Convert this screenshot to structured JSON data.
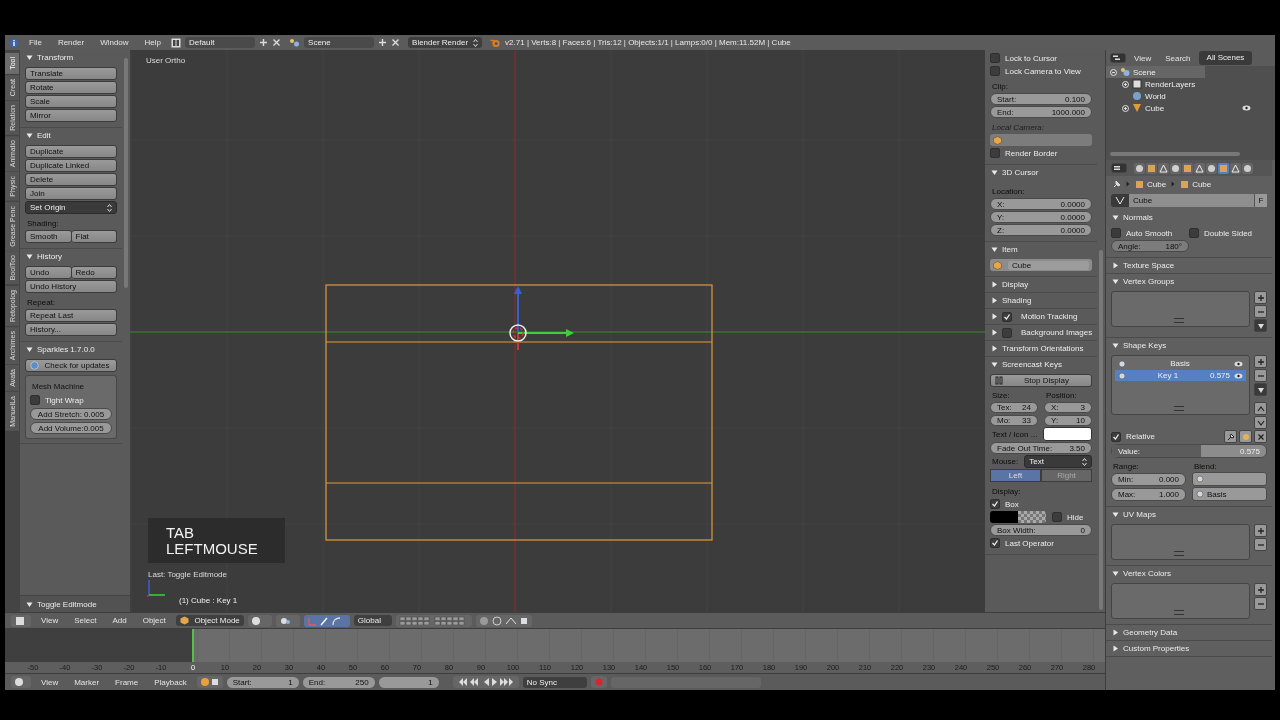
{
  "header": {
    "menus": [
      "File",
      "Render",
      "Window",
      "Help"
    ],
    "layout": "Default",
    "scene": "Scene",
    "engine": "Blender Render",
    "stats": "v2.71 | Verts:8 | Faces:6 | Tris:12 | Objects:1/1 | Lamps:0/0 | Mem:11.52M | Cube"
  },
  "tool_tabs": [
    {
      "label": "Tool",
      "selected": true
    },
    {
      "label": "Creat",
      "selected": false
    },
    {
      "label": "Relation",
      "selected": false
    },
    {
      "label": "Animatio",
      "selected": false
    },
    {
      "label": "Physic",
      "selected": false
    },
    {
      "label": "Grease Penc",
      "selected": false
    },
    {
      "label": "BoolToo",
      "selected": false
    },
    {
      "label": "Retopolog",
      "selected": false
    },
    {
      "label": "Archimes",
      "selected": false
    },
    {
      "label": "Avata",
      "selected": false
    },
    {
      "label": "ManuelLa",
      "selected": false
    }
  ],
  "tool_panel": {
    "sections": [
      {
        "title": "Transform",
        "expanded": true,
        "rows": [
          {
            "kind": "buttons",
            "labels": [
              "Translate"
            ]
          },
          {
            "kind": "buttons",
            "labels": [
              "Rotate"
            ]
          },
          {
            "kind": "buttons",
            "labels": [
              "Scale"
            ]
          },
          {
            "kind": "buttons",
            "labels": [
              "Mirror"
            ]
          }
        ]
      },
      {
        "title": "Edit",
        "expanded": true,
        "rows": [
          {
            "kind": "buttons",
            "labels": [
              "Duplicate"
            ]
          },
          {
            "kind": "buttons",
            "labels": [
              "Duplicate Linked"
            ]
          },
          {
            "kind": "buttons",
            "labels": [
              "Delete"
            ]
          },
          {
            "kind": "buttons",
            "labels": [
              "Join"
            ]
          },
          {
            "kind": "menu",
            "value": "Set Origin"
          },
          {
            "kind": "label",
            "text": "Shading:"
          },
          {
            "kind": "buttons",
            "labels": [
              "Smooth",
              "Flat"
            ]
          }
        ]
      },
      {
        "title": "History",
        "expanded": true,
        "rows": [
          {
            "kind": "buttons",
            "labels": [
              "Undo",
              "Redo"
            ]
          },
          {
            "kind": "buttons",
            "labels": [
              "Undo History"
            ]
          },
          {
            "kind": "label",
            "text": "Repeat:"
          },
          {
            "kind": "buttons",
            "labels": [
              "Repeat Last"
            ]
          },
          {
            "kind": "buttons",
            "labels": [
              "History..."
            ]
          }
        ]
      },
      {
        "title": "Sparkles 1.7.0.0",
        "expanded": true,
        "rows": [
          {
            "kind": "update_button",
            "label": "Check for updates"
          },
          {
            "kind": "box",
            "rows": [
              {
                "kind": "label",
                "text": "Mesh Machine"
              },
              {
                "kind": "checkbox",
                "label": "Tight Wrap",
                "checked": false
              },
              {
                "kind": "spin",
                "text": "Add Stretch: 0.005"
              },
              {
                "kind": "spin",
                "text": "Add Volume:0.005"
              }
            ]
          }
        ]
      }
    ],
    "operator": {
      "title": "Toggle Editmode",
      "expanded": true
    }
  },
  "viewport": {
    "view_name": "User Ortho",
    "keys": [
      "TAB",
      "LEFTMOUSE"
    ],
    "last_operator": "Last: Toggle Editmode",
    "object_info": "(1) Cube : Key 1"
  },
  "n_panel": {
    "sections": [
      {
        "rows": [
          {
            "kind": "checkbox",
            "label": "Lock to Cursor",
            "checked": false
          },
          {
            "kind": "checkbox",
            "label": "Lock Camera to View",
            "checked": false
          },
          {
            "kind": "label",
            "text": "Clip:"
          },
          {
            "kind": "number",
            "label": "Start:",
            "value": "0.100"
          },
          {
            "kind": "number",
            "label": "End:",
            "value": "1000.000"
          },
          {
            "kind": "label",
            "text": "Local Camera:",
            "disabled": true
          },
          {
            "kind": "object_field",
            "disabled": true
          },
          {
            "kind": "checkbox",
            "label": "Render Border",
            "checked": false
          }
        ]
      },
      {
        "title": "3D Cursor",
        "expanded": true,
        "rows": [
          {
            "kind": "label",
            "text": "Location:"
          },
          {
            "kind": "number",
            "label": "X:",
            "value": "0.0000"
          },
          {
            "kind": "number",
            "label": "Y:",
            "value": "0.0000"
          },
          {
            "kind": "number",
            "label": "Z:",
            "value": "0.0000"
          }
        ]
      },
      {
        "title": "Item",
        "expanded": true,
        "rows": [
          {
            "kind": "object_field",
            "value": "Cube"
          }
        ]
      },
      {
        "title": "Display",
        "expanded": false
      },
      {
        "title": "Shading",
        "expanded": false
      },
      {
        "title": "Motion Tracking",
        "expanded": false,
        "checked": true
      },
      {
        "title": "Background Images",
        "expanded": false,
        "checked": false
      },
      {
        "title": "Transform Orientations",
        "expanded": false
      },
      {
        "title": "Screencast Keys",
        "expanded": true,
        "rows": [
          {
            "kind": "pause_button",
            "label": "Stop Display"
          },
          {
            "kind": "columns",
            "columns": [
              {
                "title": "Size:",
                "rows": [
                  {
                    "kind": "number",
                    "label": "Tex:",
                    "value": "24"
                  },
                  {
                    "kind": "number",
                    "label": "Mo:",
                    "value": "33"
                  }
                ]
              },
              {
                "title": "Position:",
                "rows": [
                  {
                    "kind": "number",
                    "label": "X:",
                    "value": "3"
                  },
                  {
                    "kind": "number",
                    "label": "Y:",
                    "value": "10"
                  }
                ]
              }
            ]
          },
          {
            "kind": "color",
            "label": "Text / Icon ...",
            "color": "#ffffff"
          },
          {
            "kind": "number",
            "label": "Fade Out Time:",
            "value": "3.50"
          },
          {
            "kind": "dropdown",
            "label": "Mouse:",
            "value": "Text"
          },
          {
            "kind": "toggle",
            "items": [
              {
                "label": "Left",
                "selected": true
              },
              {
                "label": "Right",
                "selected": false
              }
            ]
          },
          {
            "kind": "label",
            "text": "Display:"
          },
          {
            "kind": "checkbox",
            "label": "Box",
            "checked": true
          },
          {
            "kind": "swatch_checkbox",
            "color": "#000000",
            "label": "Hide",
            "checked": false
          },
          {
            "kind": "number",
            "label": "Box Width:",
            "value": "0"
          },
          {
            "kind": "checkbox",
            "label": "Last Operator",
            "checked": true
          }
        ]
      }
    ]
  },
  "outliner": {
    "menus": [
      "View",
      "Search"
    ],
    "filter": "All Scenes",
    "tree": [
      {
        "label": "Scene",
        "selected": true,
        "expanded": true,
        "children": [
          {
            "kind": "layers",
            "label": "RenderLayers",
            "selected": false
          },
          {
            "kind": "world",
            "label": "World",
            "selected": false
          },
          {
            "kind": "object",
            "label": "Cube",
            "selected": false
          }
        ]
      }
    ]
  },
  "properties": {
    "header": {
      "tabs": [
        {
          "selected": false
        },
        {
          "selected": false
        },
        {
          "selected": false
        },
        {
          "selected": false
        },
        {
          "selected": false
        },
        {
          "selected": false
        },
        {
          "selected": false
        },
        {
          "selected": true
        },
        {
          "selected": false
        },
        {
          "selected": false
        }
      ],
      "breadcrumb": [
        "Cube",
        "Cube"
      ],
      "datablock": "Cube",
      "fake_user": "F"
    },
    "sections": [
      {
        "title": "Normals",
        "expanded": true,
        "rows": [
          {
            "kind": "checkboxes",
            "items": [
              {
                "label": "Auto Smooth",
                "checked": false
              },
              {
                "label": "Double Sided",
                "checked": false
              }
            ]
          },
          {
            "kind": "short_number",
            "label": "Angle:",
            "value": "180°",
            "disabled": true
          }
        ]
      },
      {
        "title": "Texture Space",
        "expanded": false
      },
      {
        "title": "Vertex Groups",
        "expanded": true,
        "rows": [
          {
            "kind": "list",
            "specials": true,
            "move": false
          }
        ]
      },
      {
        "title": "Shape Keys",
        "expanded": true,
        "rows": [
          {
            "kind": "list",
            "specials": true,
            "move": true,
            "items": [
              {
                "label": "Basis",
                "selected": false
              },
              {
                "label": "Key 1",
                "value": "0.575",
                "selected": true
              }
            ]
          },
          {
            "kind": "checkbox",
            "label": "Relative",
            "checked": true,
            "tools": true
          },
          {
            "kind": "slider",
            "label": "Value:",
            "value": "0.575",
            "level": 0.575
          },
          {
            "kind": "columns",
            "columns": [
              {
                "title": "Range:",
                "rows": [
                  {
                    "kind": "number",
                    "label": "Min:",
                    "value": "0.000"
                  },
                  {
                    "kind": "number",
                    "label": "Max:",
                    "value": "1.000"
                  }
                ]
              },
              {
                "title": "Blend:",
                "rows": [
                  {
                    "kind": "field"
                  },
                  {
                    "kind": "field",
                    "value": "Basis"
                  }
                ]
              }
            ]
          }
        ]
      },
      {
        "title": "UV Maps",
        "expanded": true,
        "rows": [
          {
            "kind": "list",
            "specials": false,
            "move": false
          }
        ]
      },
      {
        "title": "Vertex Colors",
        "expanded": true,
        "rows": [
          {
            "kind": "list",
            "specials": false,
            "move": false
          }
        ]
      },
      {
        "title": "Geometry Data",
        "expanded": false
      },
      {
        "title": "Custom Properties",
        "expanded": false
      }
    ]
  },
  "view_header": {
    "menus": [
      "View",
      "Select",
      "Add",
      "Object"
    ],
    "mode": "Object Mode",
    "orientation": "Global"
  },
  "timeline": {
    "ruler": [
      {
        "label": "-50",
        "selected": false
      },
      {
        "label": "-40",
        "selected": false
      },
      {
        "label": "-30",
        "selected": false
      },
      {
        "label": "-20",
        "selected": false
      },
      {
        "label": "-10",
        "selected": false
      },
      {
        "label": "0",
        "selected": true
      },
      {
        "label": "10",
        "selected": false
      },
      {
        "label": "20",
        "selected": false
      },
      {
        "label": "30",
        "selected": false
      },
      {
        "label": "40",
        "selected": false
      },
      {
        "label": "50",
        "selected": false
      },
      {
        "label": "60",
        "selected": false
      },
      {
        "label": "70",
        "selected": false
      },
      {
        "label": "80",
        "selected": false
      },
      {
        "label": "90",
        "selected": false
      },
      {
        "label": "100",
        "selected": false
      },
      {
        "label": "110",
        "selected": false
      },
      {
        "label": "120",
        "selected": false
      },
      {
        "label": "130",
        "selected": false
      },
      {
        "label": "140",
        "selected": false
      },
      {
        "label": "150",
        "selected": false
      },
      {
        "label": "160",
        "selected": false
      },
      {
        "label": "170",
        "selected": false
      },
      {
        "label": "180",
        "selected": false
      },
      {
        "label": "190",
        "selected": false
      },
      {
        "label": "200",
        "selected": false
      },
      {
        "label": "210",
        "selected": false
      },
      {
        "label": "220",
        "selected": false
      },
      {
        "label": "230",
        "selected": false
      },
      {
        "label": "240",
        "selected": false
      },
      {
        "label": "250",
        "selected": false
      },
      {
        "label": "260",
        "selected": false
      },
      {
        "label": "270",
        "selected": false
      },
      {
        "label": "280",
        "selected": false
      }
    ]
  },
  "timeline_header": {
    "menus": [
      "View",
      "Marker",
      "Frame",
      "Playback"
    ],
    "start": {
      "label": "Start:",
      "value": "1"
    },
    "end": {
      "label": "End:",
      "value": "250"
    },
    "frame": "1",
    "sync": "No Sync"
  }
}
